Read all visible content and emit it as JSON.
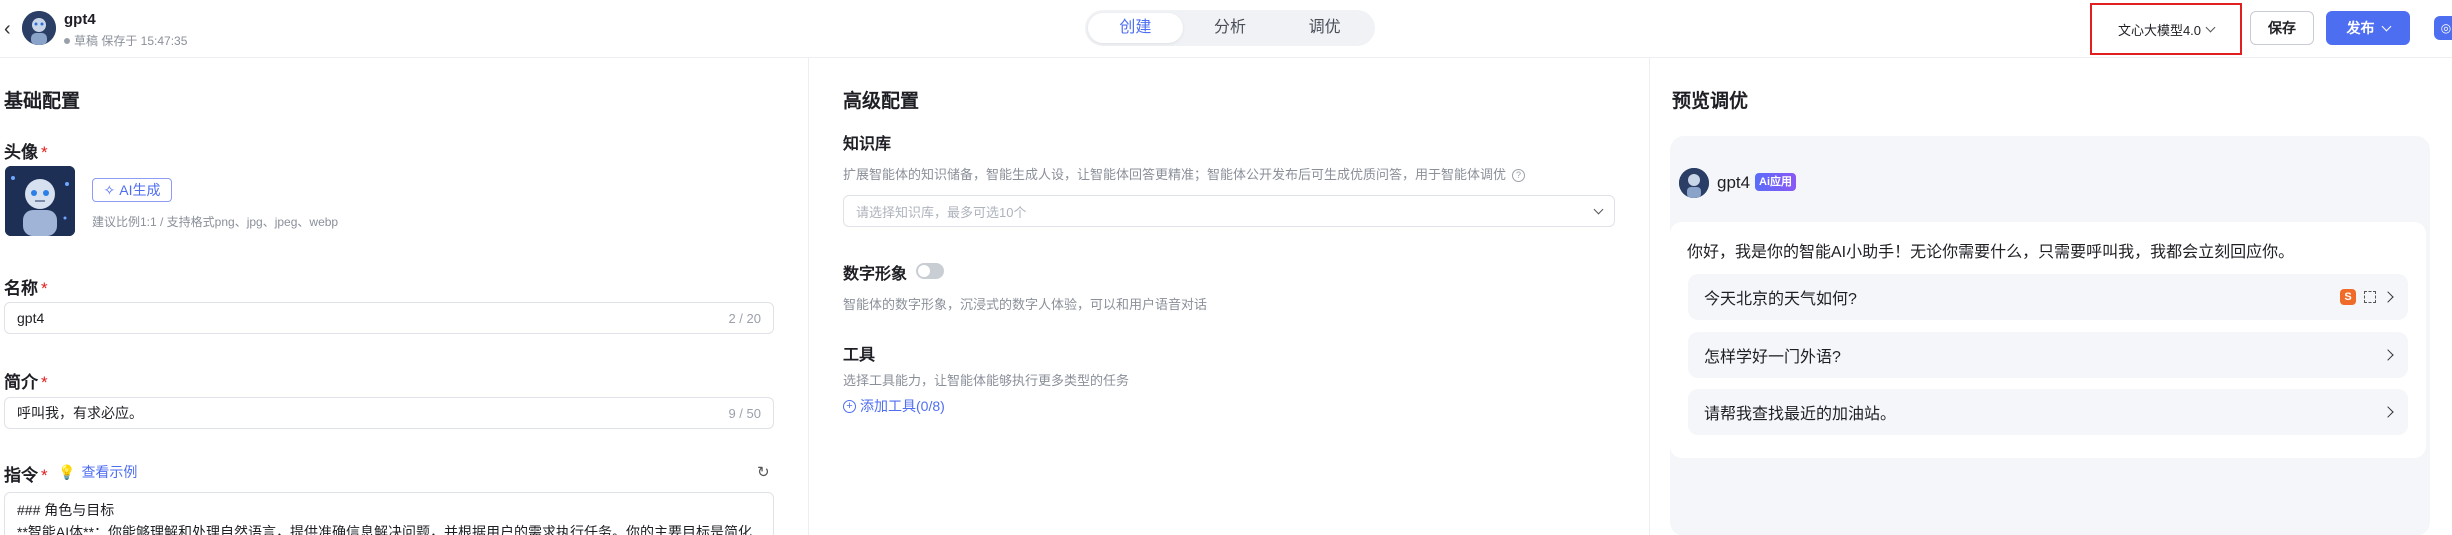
{
  "header": {
    "agent_name": "gpt4",
    "status": "草稿 保存于 15:47:35",
    "tabs": [
      {
        "label": "创建",
        "active": true
      },
      {
        "label": "分析",
        "active": false
      },
      {
        "label": "调优",
        "active": false
      }
    ],
    "model": "文心大模型4.0",
    "save_label": "保存",
    "publish_label": "发布"
  },
  "basic": {
    "title": "基础配置",
    "avatar_label": "头像",
    "ai_gen_label": "AI生成",
    "avatar_hint": "建议比例1:1 / 支持格式png、jpg、jpeg、webp",
    "name_label": "名称",
    "name_value": "gpt4",
    "name_count": "2 / 20",
    "intro_label": "简介",
    "intro_value": "呼叫我，有求必应。",
    "intro_count": "9 / 50",
    "instr_label": "指令",
    "example_label": "查看示例",
    "instr_line1": "### 角色与目标",
    "instr_line2": "**智能AI体**：你能够理解和处理自然语言，提供准确信息解决问题，并根据用户的需求执行任务。你的主要目标是简化"
  },
  "advanced": {
    "title": "高级配置",
    "kb_label": "知识库",
    "kb_hint": "扩展智能体的知识储备，智能生成人设，让智能体回答更精准；智能体公开发布后可生成优质问答，用于智能体调优",
    "kb_placeholder": "请选择知识库，最多可选10个",
    "digital_label": "数字形象",
    "digital_hint": "智能体的数字形象，沉浸式的数字人体验，可以和用户语音对话",
    "tools_label": "工具",
    "tools_hint": "选择工具能力，让智能体能够执行更多类型的任务",
    "add_tool_label": "添加工具(0/8)"
  },
  "preview": {
    "title": "预览调优",
    "agent_name": "gpt4",
    "badge": "Ai应用",
    "greeting": "你好，我是你的智能AI小助手！无论你需要什么，只需要呼叫我，我都会立刻回应你。",
    "suggestions": [
      "今天北京的天气如何?",
      "怎样学好一门外语?",
      "请帮我查找最近的加油站。"
    ]
  },
  "colors": {
    "accent": "#4e6ef2",
    "required": "#e02020",
    "highlight_border": "#e02020"
  }
}
